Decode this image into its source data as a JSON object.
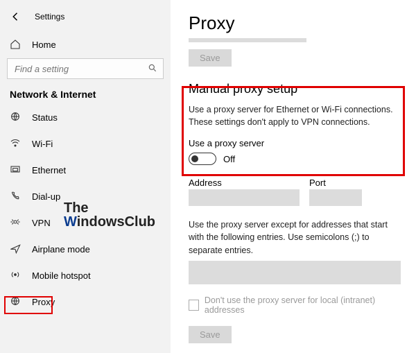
{
  "window": {
    "title": "Settings"
  },
  "sidebar": {
    "home": "Home",
    "search_placeholder": "Find a setting",
    "section": "Network & Internet",
    "items": [
      {
        "label": "Status"
      },
      {
        "label": "Wi-Fi"
      },
      {
        "label": "Ethernet"
      },
      {
        "label": "Dial-up"
      },
      {
        "label": "VPN"
      },
      {
        "label": "Airplane mode"
      },
      {
        "label": "Mobile hotspot"
      },
      {
        "label": "Proxy"
      }
    ]
  },
  "watermark": {
    "line1": "The",
    "line2a": "W",
    "line2b": "indowsClub"
  },
  "main": {
    "title": "Proxy",
    "save": "Save",
    "manual_heading": "Manual proxy setup",
    "manual_desc": "Use a proxy server for Ethernet or Wi-Fi connections. These settings don't apply to VPN connections.",
    "use_proxy_label": "Use a proxy server",
    "toggle_state": "Off",
    "address_label": "Address",
    "port_label": "Port",
    "except_text": "Use the proxy server except for addresses that start with the following entries. Use semicolons (;) to separate entries.",
    "local_checkbox": "Don't use the proxy server for local (intranet) addresses",
    "save2": "Save"
  }
}
